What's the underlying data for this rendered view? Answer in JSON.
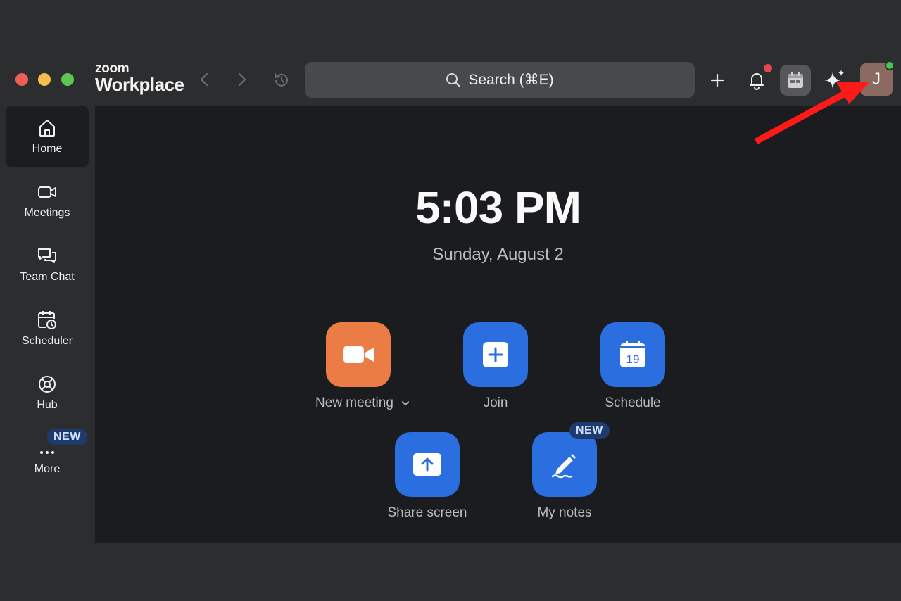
{
  "window": {
    "traffic_lights": [
      "close",
      "minimize",
      "zoom"
    ]
  },
  "brand": {
    "line1": "zoom",
    "line2": "Workplace"
  },
  "search": {
    "label": "Search (⌘E)"
  },
  "toolbar": {
    "avatar_initial": "J",
    "notification_dot_color": "#e5474f",
    "presence_color": "#3ec94a"
  },
  "sidebar": {
    "items": [
      {
        "label": "Home",
        "icon": "home-icon"
      },
      {
        "label": "Meetings",
        "icon": "video-icon"
      },
      {
        "label": "Team Chat",
        "icon": "chat-icon"
      },
      {
        "label": "Scheduler",
        "icon": "scheduler-icon"
      },
      {
        "label": "Hub",
        "icon": "hub-icon"
      },
      {
        "label": "More",
        "icon": "more-icon",
        "badge": "NEW"
      }
    ]
  },
  "main": {
    "time": "5:03 PM",
    "date": "Sunday, August 2",
    "actions": [
      {
        "label": "New meeting",
        "icon": "video-camera-icon",
        "color": "#ec7c45"
      },
      {
        "label": "Join",
        "icon": "plus-icon",
        "color": "#2a6ee0"
      },
      {
        "label": "Schedule",
        "icon": "calendar-icon",
        "color": "#2a6ee0",
        "calendar_day": "19"
      },
      {
        "label": "Share screen",
        "icon": "share-up-arrow-icon",
        "color": "#2a6ee0"
      },
      {
        "label": "My notes",
        "icon": "pen-icon",
        "color": "#2a6ee0",
        "badge": "NEW"
      }
    ]
  },
  "annotation": {
    "arrow_color": "#ff1a1a"
  }
}
